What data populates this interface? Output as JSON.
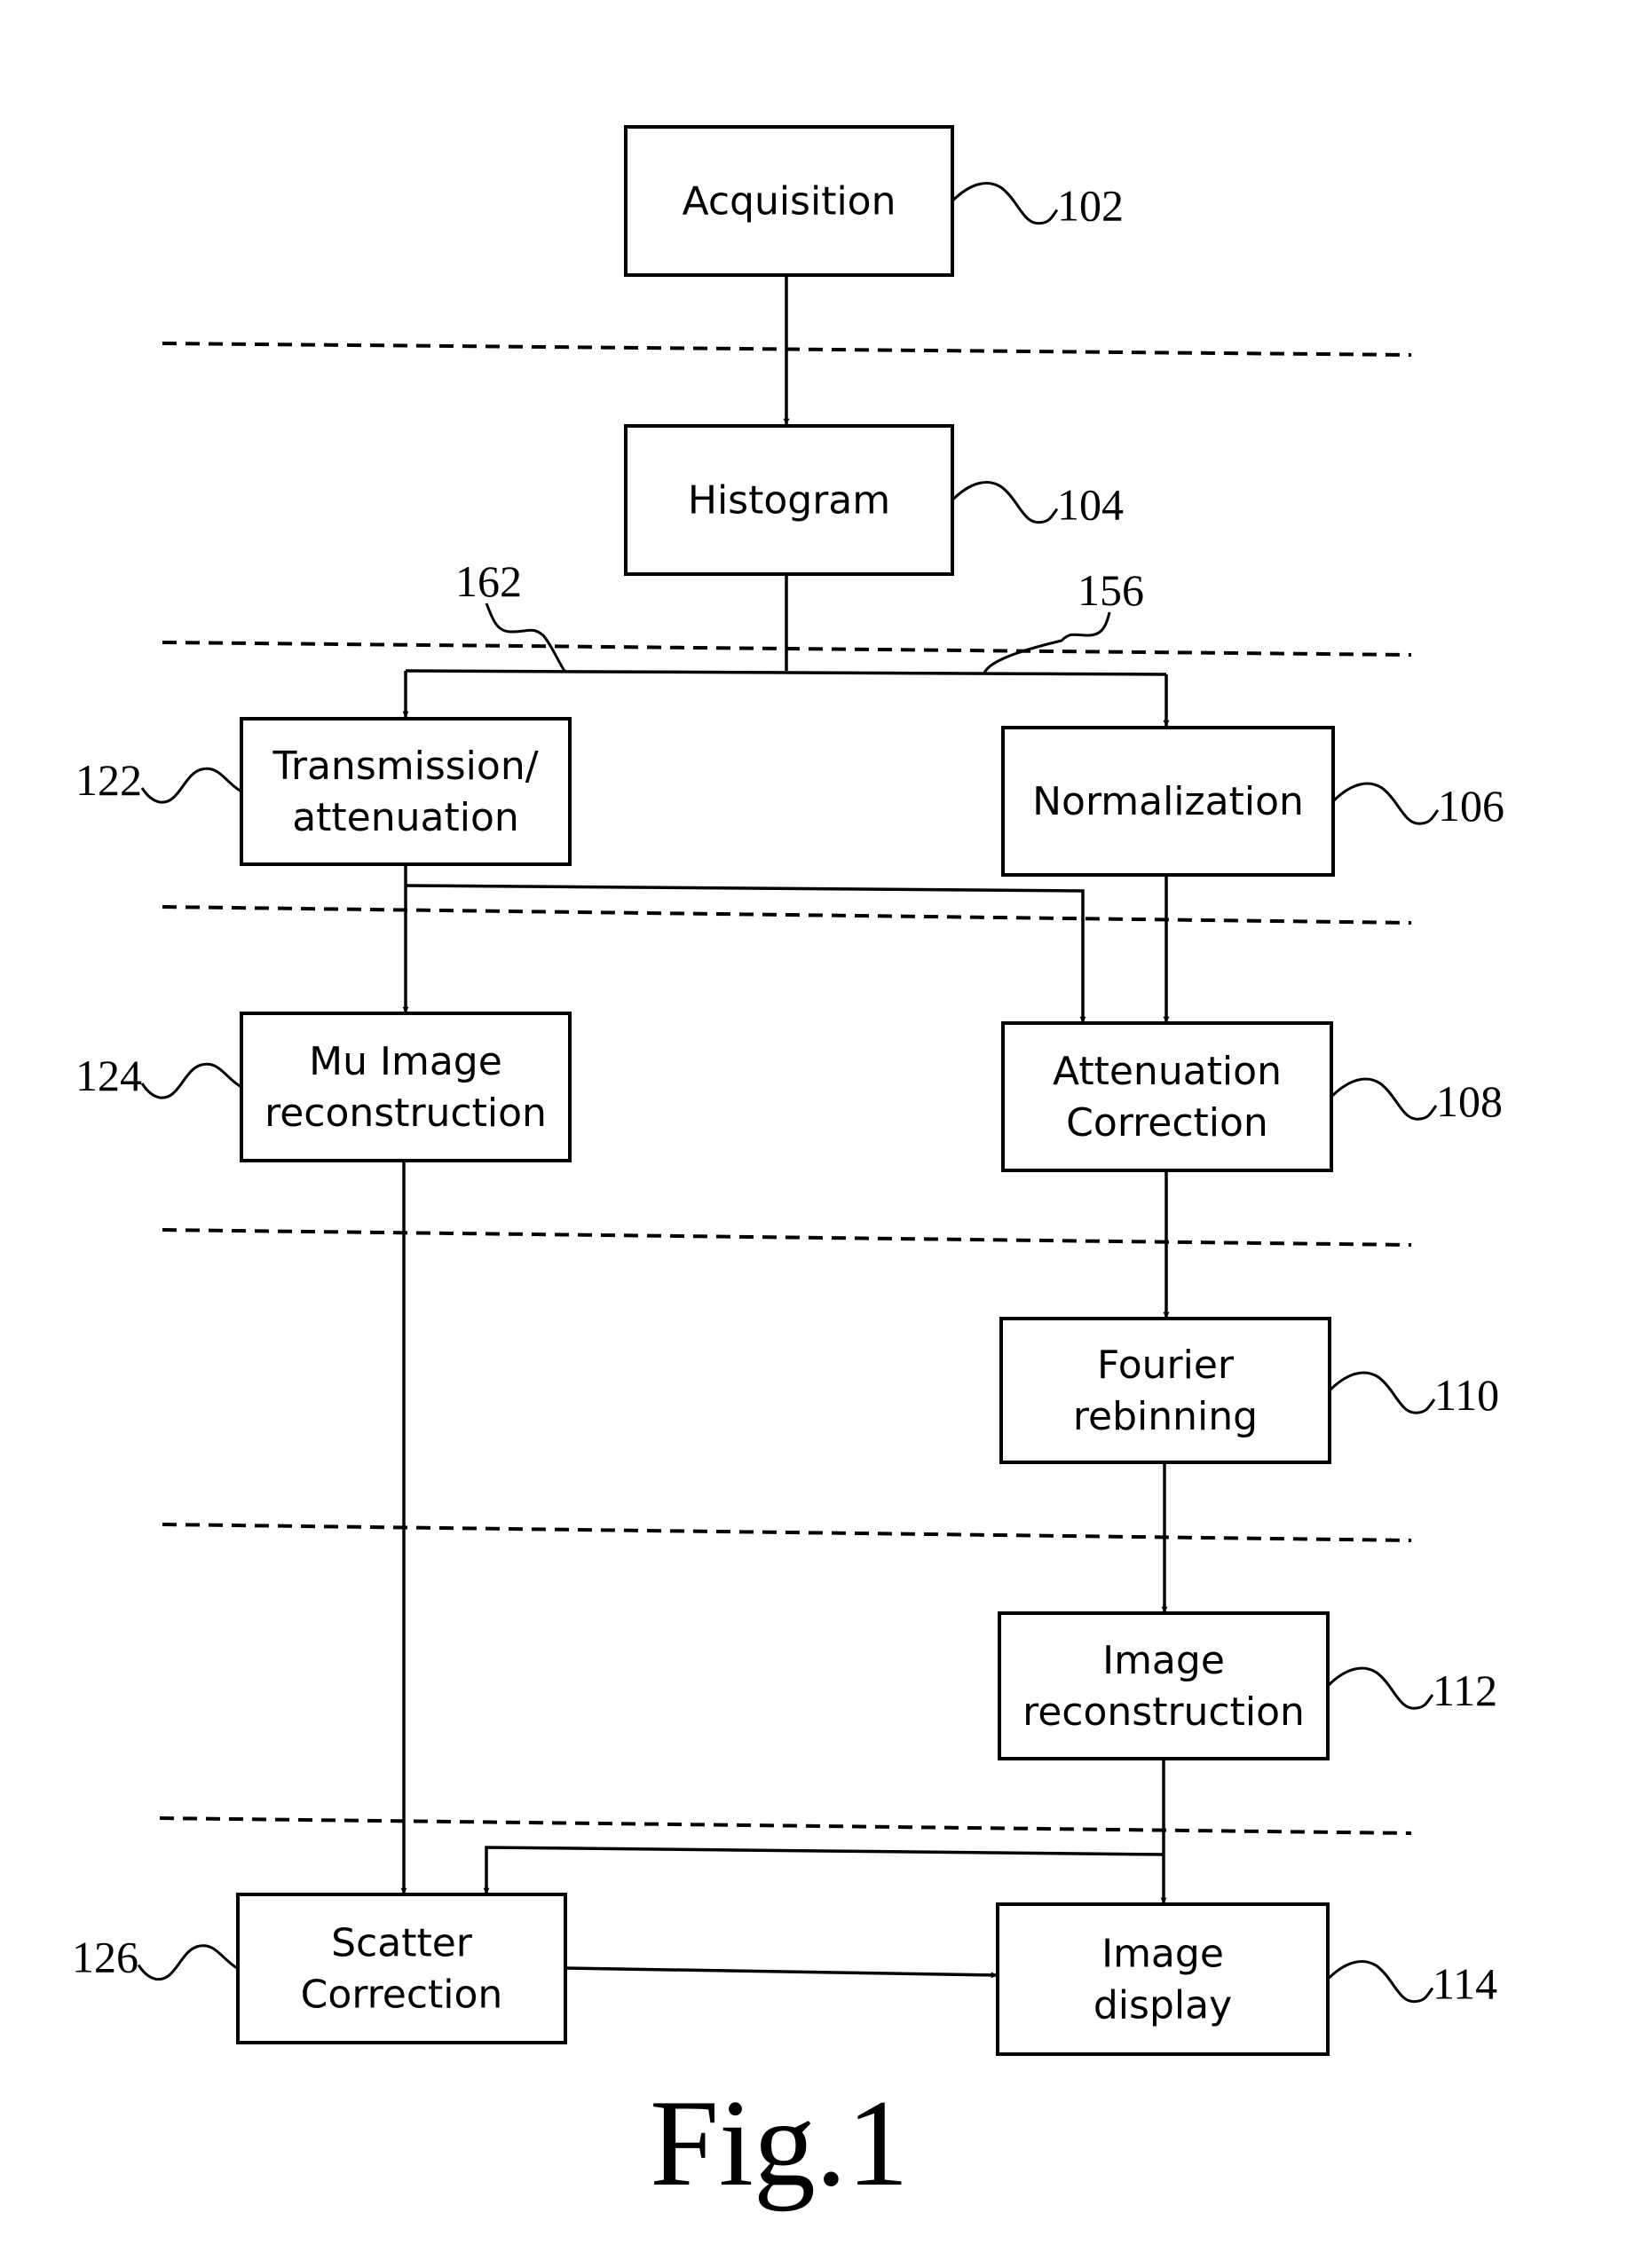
{
  "figure": {
    "caption": "Fig.1",
    "blocks": [
      {
        "id": "acquisition",
        "lines": [
          "Acquisition"
        ],
        "ref": "102"
      },
      {
        "id": "histogram",
        "lines": [
          "Histogram"
        ],
        "ref": "104"
      },
      {
        "id": "transmission",
        "lines": [
          "Transmission/",
          "attenuation"
        ],
        "ref": "122"
      },
      {
        "id": "normalization",
        "lines": [
          "Normalization"
        ],
        "ref": "106"
      },
      {
        "id": "mu-image",
        "lines": [
          "Mu Image",
          "reconstruction"
        ],
        "ref": "124"
      },
      {
        "id": "attenuation-correction",
        "lines": [
          "Attenuation",
          "Correction"
        ],
        "ref": "108"
      },
      {
        "id": "fourier",
        "lines": [
          "Fourier",
          "rebinning"
        ],
        "ref": "110"
      },
      {
        "id": "image-reconstruction",
        "lines": [
          "Image",
          "reconstruction"
        ],
        "ref": "112"
      },
      {
        "id": "scatter",
        "lines": [
          "Scatter",
          "Correction"
        ],
        "ref": "126"
      },
      {
        "id": "image-display",
        "lines": [
          "Image",
          "display"
        ],
        "ref": "114"
      }
    ],
    "branch_refs": {
      "left": "162",
      "right": "156"
    },
    "edges": [
      [
        "acquisition",
        "histogram"
      ],
      [
        "histogram",
        "transmission"
      ],
      [
        "histogram",
        "normalization"
      ],
      [
        "transmission",
        "mu-image"
      ],
      [
        "transmission",
        "attenuation-correction"
      ],
      [
        "normalization",
        "attenuation-correction"
      ],
      [
        "attenuation-correction",
        "fourier"
      ],
      [
        "fourier",
        "image-reconstruction"
      ],
      [
        "image-reconstruction",
        "image-display"
      ],
      [
        "image-reconstruction",
        "scatter"
      ],
      [
        "mu-image",
        "scatter"
      ],
      [
        "scatter",
        "image-display"
      ]
    ]
  }
}
